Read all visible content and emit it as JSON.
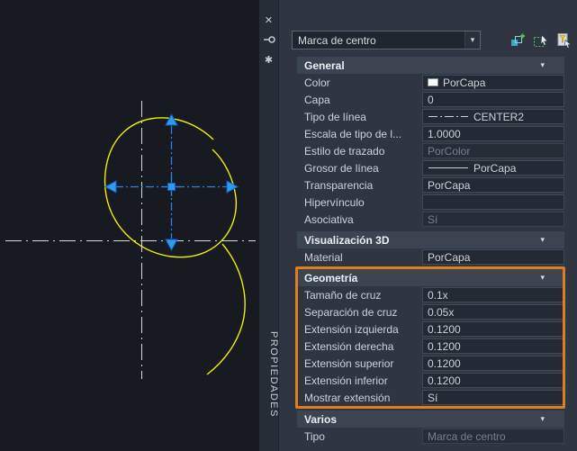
{
  "colors": {
    "canvas_bg": "#171b21",
    "palette_bg": "#2f3641",
    "section_header_bg": "#3b4551",
    "highlight_orange": "#e07d1c",
    "curve_yellow": "#f0f000",
    "centerline_white": "#dcdcdc",
    "centermark_blue": "#2e80d8",
    "grip_blue": "#2d9bf0"
  },
  "icons": {
    "close": "✕",
    "auto_hide": "pin-icon",
    "menu": "✱",
    "dropdown_chevron": "▾",
    "section_chevron": "▾",
    "toolbar": [
      "toggle-pickadd-icon",
      "select-objects-icon",
      "quick-select-icon"
    ]
  },
  "palette": {
    "title": "PROPIEDADES",
    "selector": {
      "value": "Marca de centro"
    },
    "sections": [
      {
        "label": "General",
        "rows": [
          {
            "label": "Color",
            "value": "PorCapa",
            "type": "color",
            "swatch": "#ffffff"
          },
          {
            "label": "Capa",
            "value": "0",
            "type": "text"
          },
          {
            "label": "Tipo de línea",
            "value": "CENTER2",
            "type": "linetype"
          },
          {
            "label": "Escala de tipo de l...",
            "value": "1.0000",
            "type": "text"
          },
          {
            "label": "Estilo de trazado",
            "value": "PorColor",
            "type": "text",
            "disabled": true
          },
          {
            "label": "Grosor de línea",
            "value": "PorCapa",
            "type": "lineweight"
          },
          {
            "label": "Transparencia",
            "value": "PorCapa",
            "type": "text"
          },
          {
            "label": "Hipervínculo",
            "value": "",
            "type": "text"
          },
          {
            "label": "Asociativa",
            "value": "Sí",
            "type": "text",
            "disabled": true
          }
        ]
      },
      {
        "label": "Visualización 3D",
        "rows": [
          {
            "label": "Material",
            "value": "PorCapa",
            "type": "text"
          }
        ]
      },
      {
        "label": "Geometría",
        "highlighted": true,
        "rows": [
          {
            "label": "Tamaño de cruz",
            "value": "0.1x",
            "type": "text"
          },
          {
            "label": "Separación de cruz",
            "value": "0.05x",
            "type": "text"
          },
          {
            "label": "Extensión izquierda",
            "value": "0.1200",
            "type": "text"
          },
          {
            "label": "Extensión derecha",
            "value": "0.1200",
            "type": "text"
          },
          {
            "label": "Extensión superior",
            "value": "0.1200",
            "type": "text"
          },
          {
            "label": "Extensión inferior",
            "value": "0.1200",
            "type": "text"
          },
          {
            "label": "Mostrar extensión",
            "value": "Sí",
            "type": "text"
          }
        ]
      },
      {
        "label": "Varios",
        "rows": [
          {
            "label": "Tipo",
            "value": "Marca de centro",
            "type": "text",
            "disabled": true
          }
        ]
      }
    ]
  }
}
